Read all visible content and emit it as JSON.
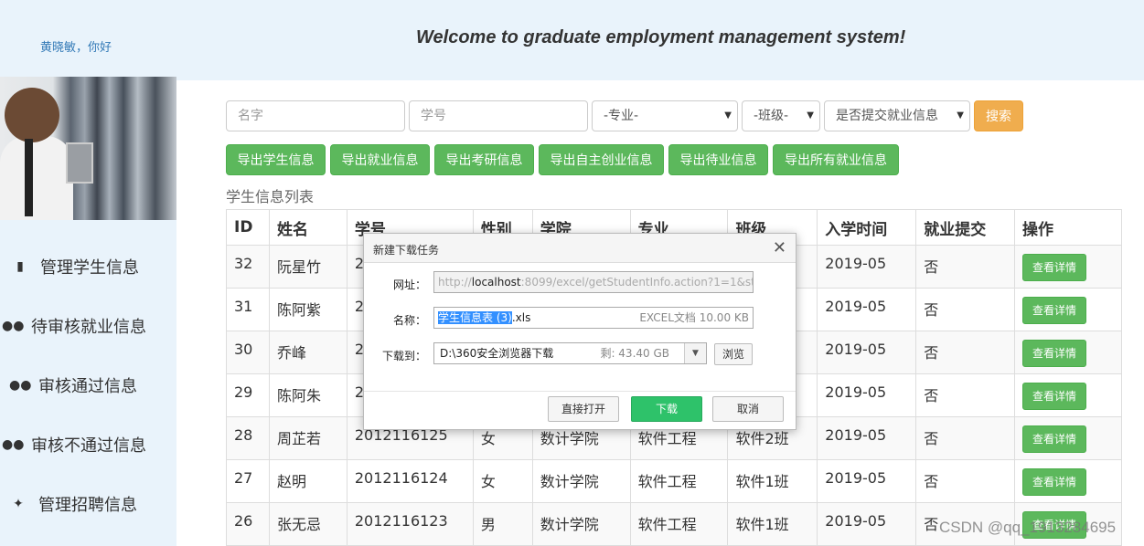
{
  "header": {
    "greeting": "黄晓敏，你好",
    "welcome": "Welcome to graduate employment management system!"
  },
  "sidebar": {
    "items": [
      {
        "label": "管理学生信息",
        "icon": "book-icon"
      },
      {
        "label": "待审核就业信息",
        "icon": "users-icon"
      },
      {
        "label": "审核通过信息",
        "icon": "users-icon"
      },
      {
        "label": "审核不通过信息",
        "icon": "users-icon"
      },
      {
        "label": "管理招聘信息",
        "icon": "twitter-icon"
      }
    ]
  },
  "search": {
    "name_placeholder": "名字",
    "id_placeholder": "学号",
    "major": "-专业-",
    "class": "-班级-",
    "submitted": "是否提交就业信息",
    "search_label": "搜索"
  },
  "exports": [
    "导出学生信息",
    "导出就业信息",
    "导出考研信息",
    "导出自主创业信息",
    "导出待业信息",
    "导出所有就业信息"
  ],
  "list_title": "学生信息列表",
  "table": {
    "headers": [
      "ID",
      "姓名",
      "学号",
      "性别",
      "学院",
      "专业",
      "班级",
      "入学时间",
      "就业提交",
      "操作"
    ],
    "rows": [
      [
        "32",
        "阮星竹",
        "2",
        "",
        "",
        "",
        "",
        "2019-05",
        "否",
        "查看详情"
      ],
      [
        "31",
        "陈阿紫",
        "2",
        "",
        "",
        "",
        "",
        "2019-05",
        "否",
        "查看详情"
      ],
      [
        "30",
        "乔峰",
        "2",
        "",
        "",
        "",
        "",
        "2019-05",
        "否",
        "查看详情"
      ],
      [
        "29",
        "陈阿朱",
        "2",
        "",
        "",
        "",
        "",
        "2019-05",
        "否",
        "查看详情"
      ],
      [
        "28",
        "周芷若",
        "2012116125",
        "女",
        "数计学院",
        "软件工程",
        "软件2班",
        "2019-05",
        "否",
        "查看详情"
      ],
      [
        "27",
        "赵明",
        "2012116124",
        "女",
        "数计学院",
        "软件工程",
        "软件1班",
        "2019-05",
        "否",
        "查看详情"
      ],
      [
        "26",
        "张无忌",
        "2012116123",
        "男",
        "数计学院",
        "软件工程",
        "软件1班",
        "2019-05",
        "否",
        "查看详情"
      ]
    ]
  },
  "dialog": {
    "title": "新建下载任务",
    "url_label": "网址：",
    "url_prefix": "http://",
    "url_host": "localhost",
    "url_rest": ":8099/excel/getStudentInfo.action?1=1&stul",
    "name_label": "名称：",
    "name_selected": "学生信息表 (3)",
    "name_ext": ".xls",
    "file_info": "EXCEL文档 10.00 KB",
    "dest_label": "下载到：",
    "dest_path": "D:\\360安全浏览器下载",
    "free_space": "剩: 43.40 GB",
    "browse": "浏览",
    "open_direct": "直接打开",
    "download": "下载",
    "cancel": "取消"
  },
  "watermark": "CSDN @qq_1913284695"
}
